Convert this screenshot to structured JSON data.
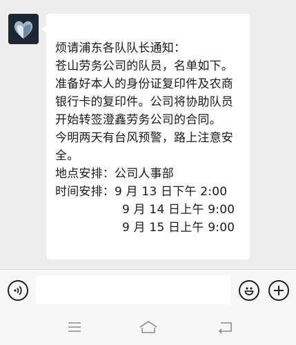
{
  "chat": {
    "message_lines": [
      "烦请浦东各队队长通知：",
      "苍山劳务公司的队员，名单如下。",
      "准备好本人的身份证复印件及农商",
      "银行卡的复印件。公司将协助队员",
      "开始转签澄鑫劳务公司的合同。",
      "今明两天有台风预警，路上注意安",
      "全。",
      "地点安排：公司人事部",
      "时间安排：9 月 13 日下午 2:00",
      "9 月 14 日上午 9:00",
      "9 月 15 日上午 9:00"
    ]
  },
  "input_bar": {
    "message_input_value": "",
    "voice_icon": "voice-icon",
    "emoji_icon": "emoji-icon",
    "plus_icon": "plus-icon"
  },
  "nav_bar": {
    "menu_icon": "menu-icon",
    "home_icon": "home-icon",
    "back_icon": "back-icon"
  }
}
